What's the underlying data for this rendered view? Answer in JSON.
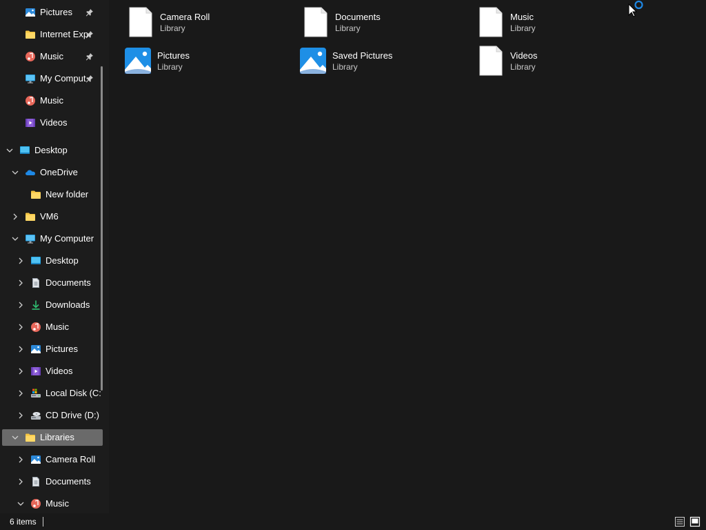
{
  "sidebar": {
    "items": [
      {
        "label": "Pictures",
        "icon": "pictures-icon",
        "pinned": true
      },
      {
        "label": "Internet Exp",
        "icon": "folder-icon",
        "pinned": true
      },
      {
        "label": "Music",
        "icon": "music-icon",
        "pinned": true
      },
      {
        "label": "My Comput",
        "icon": "computer-icon",
        "pinned": true
      },
      {
        "label": "Music",
        "icon": "music-icon"
      },
      {
        "label": "Videos",
        "icon": "videos-icon"
      },
      {
        "label": "Desktop",
        "icon": "desktop-icon",
        "expanded": true
      },
      {
        "label": "OneDrive",
        "icon": "onedrive-icon",
        "expanded": true
      },
      {
        "label": "New folder",
        "icon": "folder-icon"
      },
      {
        "label": "VM6",
        "icon": "folder-icon",
        "expanded": false
      },
      {
        "label": "My Computer",
        "icon": "computer-icon",
        "expanded": true
      },
      {
        "label": "Desktop",
        "icon": "desktop-icon",
        "expanded": false
      },
      {
        "label": "Documents",
        "icon": "documents-icon",
        "expanded": false
      },
      {
        "label": "Downloads",
        "icon": "downloads-icon",
        "expanded": false
      },
      {
        "label": "Music",
        "icon": "music-icon",
        "expanded": false
      },
      {
        "label": "Pictures",
        "icon": "pictures-icon",
        "expanded": false
      },
      {
        "label": "Videos",
        "icon": "videos-icon",
        "expanded": false
      },
      {
        "label": "Local Disk (C:",
        "icon": "local-disk-icon",
        "expanded": false
      },
      {
        "label": "CD Drive (D:)",
        "icon": "cd-drive-icon",
        "expanded": false
      },
      {
        "label": "Libraries",
        "icon": "folder-icon",
        "expanded": true,
        "selected": true
      },
      {
        "label": "Camera Roll",
        "icon": "pictures-icon",
        "expanded": false
      },
      {
        "label": "Documents",
        "icon": "documents-icon",
        "expanded": false
      },
      {
        "label": "Music",
        "icon": "music-icon",
        "expanded": true
      }
    ]
  },
  "content": {
    "items": [
      {
        "name": "Camera Roll",
        "type": "Library",
        "icon": "blank-document-icon"
      },
      {
        "name": "Documents",
        "type": "Library",
        "icon": "blank-document-icon"
      },
      {
        "name": "Music",
        "type": "Library",
        "icon": "blank-document-icon"
      },
      {
        "name": "Pictures",
        "type": "Library",
        "icon": "pictures-library-icon"
      },
      {
        "name": "Saved Pictures",
        "type": "Library",
        "icon": "pictures-library-icon"
      },
      {
        "name": "Videos",
        "type": "Library",
        "icon": "blank-document-icon"
      }
    ]
  },
  "status": {
    "item_count": "6 items"
  },
  "colors": {
    "background": "#191919",
    "sidebar_selected": "#6a6a6a",
    "accent_blue": "#1e88e5",
    "folder_yellow": "#f5c542"
  }
}
